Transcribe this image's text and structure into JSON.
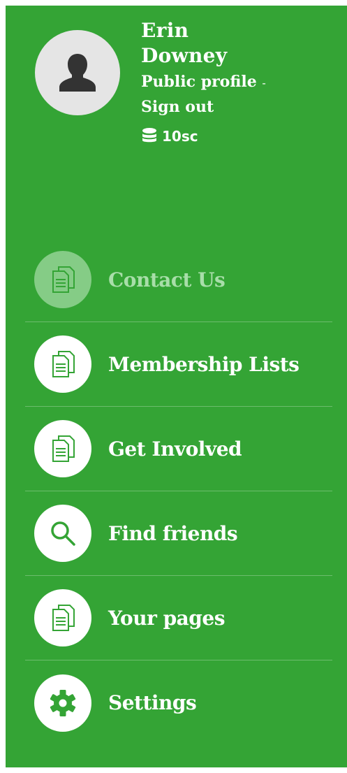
{
  "profile": {
    "first_name": "Erin",
    "last_name": "Downey",
    "public_profile_label": "Public profile",
    "separator": "-",
    "sign_out_label": "Sign out",
    "credits": "10sc",
    "avatar_icon": "user-silhouette-icon"
  },
  "menu": {
    "items": [
      {
        "label": "Contact Us",
        "icon": "pages-icon",
        "active": true
      },
      {
        "label": "Membership Lists",
        "icon": "pages-icon",
        "active": false
      },
      {
        "label": "Get Involved",
        "icon": "pages-icon",
        "active": false
      },
      {
        "label": "Find friends",
        "icon": "search-icon",
        "active": false
      },
      {
        "label": "Your pages",
        "icon": "pages-icon",
        "active": false
      },
      {
        "label": "Settings",
        "icon": "gear-icon",
        "active": false
      }
    ]
  },
  "colors": {
    "panel_bg": "#34a435",
    "active_icon_bg": "#85cc86",
    "active_label": "#a8dea9",
    "icon_fg": "#34a435",
    "avatar_bg": "#e5e5e5",
    "avatar_icon": "#333333"
  }
}
